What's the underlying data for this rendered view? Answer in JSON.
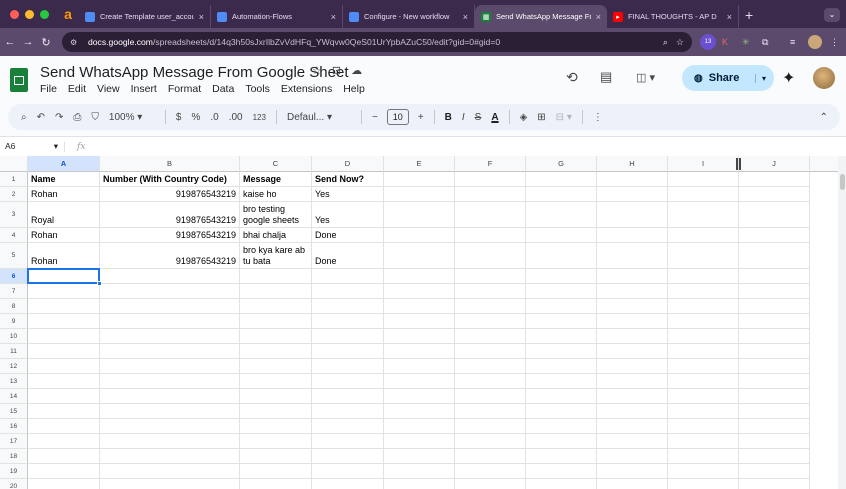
{
  "browser": {
    "tabs": [
      {
        "title": "",
        "icon": "amazon-icon"
      },
      {
        "title": "Create Template user_account",
        "icon": "doc-icon"
      },
      {
        "title": "Automation-Flows",
        "icon": "doc-icon"
      },
      {
        "title": "Configure - New workflow",
        "icon": "doc-icon"
      },
      {
        "title": "Send WhatsApp Message Fro",
        "icon": "sheets-icon",
        "active": true
      },
      {
        "title": "FINAL THOUGHTS - AP D",
        "icon": "youtube-icon"
      }
    ],
    "url_host": "docs.google.com",
    "url_path": "/spreadsheets/d/14q3h50sJxrIlbZvVdHFq_YWqvw0QeS01UrYpbAZuC50/edit?gid=0#gid=0",
    "extension_badge": "13"
  },
  "doc": {
    "title": "Send WhatsApp Message From Google Sheet",
    "menu": [
      "File",
      "Edit",
      "View",
      "Insert",
      "Format",
      "Data",
      "Tools",
      "Extensions",
      "Help"
    ],
    "share_label": "Share"
  },
  "toolbar": {
    "zoom": "100%",
    "currency": "$",
    "percent": "%",
    "dec_decrease": ".0",
    "dec_increase": ".00",
    "number_format": "123",
    "font": "Defaul...",
    "font_size": "10",
    "bold": "B",
    "italic": "I",
    "strike": "S",
    "text_color": "A"
  },
  "formula_bar": {
    "cell_ref": "A6",
    "fx": "fx",
    "value": ""
  },
  "grid": {
    "columns": [
      "A",
      "B",
      "C",
      "D",
      "E",
      "F",
      "G",
      "H",
      "I",
      "J"
    ],
    "rows": [
      "1",
      "2",
      "3",
      "4",
      "5",
      "6",
      "7",
      "8",
      "9",
      "10",
      "11",
      "12",
      "13",
      "14",
      "15",
      "16",
      "17",
      "18",
      "19",
      "20"
    ],
    "header_row": [
      "Name",
      "Number (With Country Code)",
      "Message",
      "Send Now?"
    ],
    "data": [
      [
        "Rohan",
        "919876543219",
        "kaise ho",
        "Yes"
      ],
      [
        "Royal",
        "919876543219",
        "bro testing google sheets",
        "Yes"
      ],
      [
        "Rohan",
        "919876543219",
        "bhai chalja",
        "Done"
      ],
      [
        "Rohan",
        "919876543219",
        "bro kya kare ab tu bata",
        "Done"
      ]
    ],
    "selected_cell": "A6"
  },
  "colors": {
    "accent": "#1a73e8",
    "share_bg": "#c2e7ff",
    "sheets_green": "#188038"
  }
}
